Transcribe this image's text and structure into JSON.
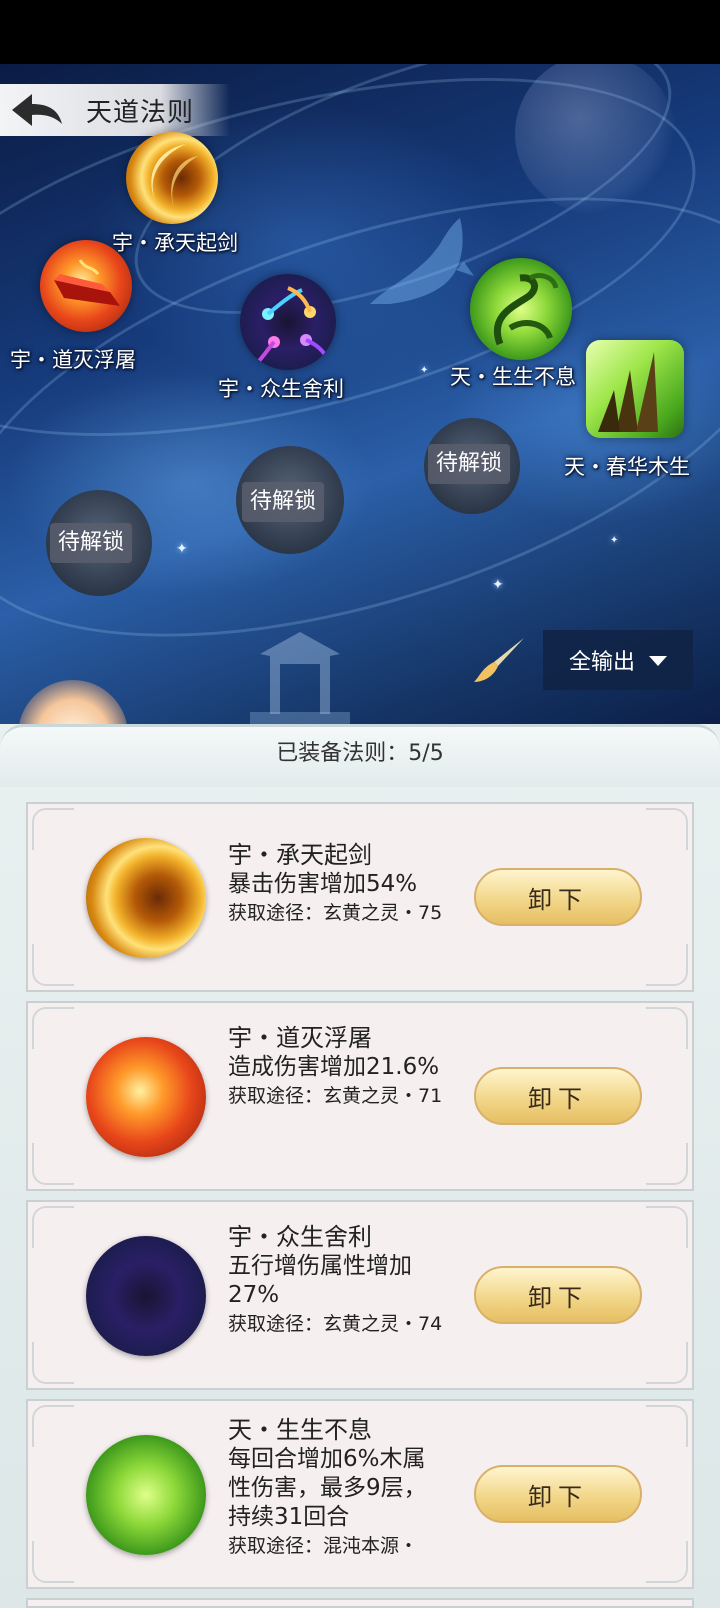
{
  "header": {
    "title": "天道法则"
  },
  "map": {
    "nodes": [
      {
        "name": "宇・承天起剑",
        "icon": "golden-sword-orb-icon",
        "unlocked": true
      },
      {
        "name": "宇・道灭浮屠",
        "icon": "red-crystal-orb-icon",
        "unlocked": true
      },
      {
        "name": "宇・众生舍利",
        "icon": "spirit-wisps-orb-icon",
        "unlocked": true
      },
      {
        "name": "天・生生不息",
        "icon": "green-vine-orb-icon",
        "unlocked": true
      },
      {
        "name": "天・春华木生",
        "icon": "wooden-spikes-icon",
        "unlocked": true
      }
    ],
    "locked": [
      "待解锁",
      "待解锁",
      "待解锁"
    ],
    "filter": {
      "label": "全输出"
    }
  },
  "panel": {
    "equipped_label": "已装备法则：5/5",
    "cards": [
      {
        "name": "宇・承天起剑",
        "effect": "暴击伤害增加54%",
        "source": "获取途径：玄黄之灵・75",
        "button": "卸下"
      },
      {
        "name": "宇・道灭浮屠",
        "effect": "造成伤害增加21.6%",
        "source": "获取途径：玄黄之灵・71",
        "button": "卸下"
      },
      {
        "name": "宇・众生舍利",
        "effect": "五行增伤属性增加27%",
        "source": "获取途径：玄黄之灵・74",
        "button": "卸下"
      },
      {
        "name": "天・生生不息",
        "effect": "每回合增加6%木属性伤害，最多9层，持续31回合",
        "source": "获取途径：混沌本源・",
        "button": "卸下"
      }
    ]
  }
}
